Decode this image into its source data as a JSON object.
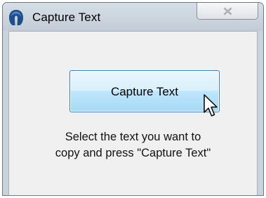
{
  "window": {
    "title": "Capture Text",
    "icon": "app-logo-icon",
    "close_icon": "close-icon"
  },
  "main": {
    "button_label": "Capture Text",
    "instructions_line1": "Select the text you want to",
    "instructions_line2": "copy and press \"Capture Text\""
  },
  "cursor": {
    "icon": "hand-pointer-cursor-icon"
  },
  "colors": {
    "window_frame": "#c9d3dc",
    "client_background": "#f0f0f0",
    "button_border": "#3c7fb1",
    "button_fill": "#bee6fd",
    "icon_blue": "#1e4f8c"
  }
}
